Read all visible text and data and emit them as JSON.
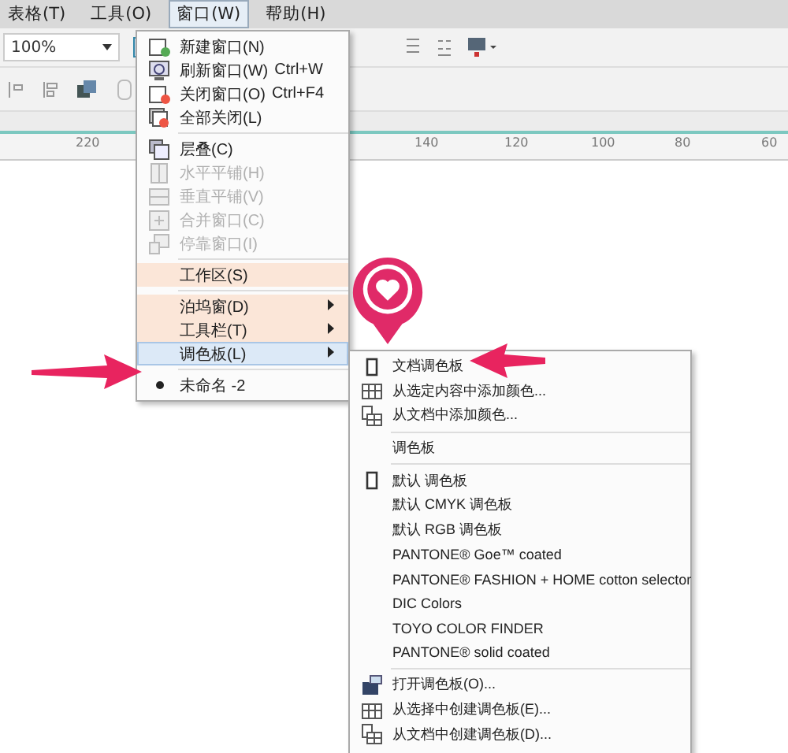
{
  "menubar": [
    {
      "label": "表格(T)",
      "selected": false
    },
    {
      "label": "工具(O)",
      "selected": false
    },
    {
      "label": "窗口(W)",
      "selected": true
    },
    {
      "label": "帮助(H)",
      "selected": false
    }
  ],
  "toolbar": {
    "zoom": "100%"
  },
  "ruler": {
    "labels": [
      "220",
      "140",
      "120",
      "100",
      "80",
      "60"
    ]
  },
  "window_menu": [
    {
      "kind": "item",
      "label": "新建窗口(N)",
      "disabled": false
    },
    {
      "kind": "item",
      "label": "刷新窗口(W)",
      "shortcut": "Ctrl+W",
      "disabled": false
    },
    {
      "kind": "item",
      "label": "关闭窗口(O)",
      "shortcut": "Ctrl+F4",
      "disabled": false
    },
    {
      "kind": "item",
      "label": "全部关闭(L)",
      "disabled": false
    },
    {
      "kind": "separator"
    },
    {
      "kind": "item",
      "label": "层叠(C)",
      "disabled": false
    },
    {
      "kind": "item",
      "label": "水平平铺(H)",
      "disabled": true
    },
    {
      "kind": "item",
      "label": "垂直平铺(V)",
      "disabled": true
    },
    {
      "kind": "item",
      "label": "合并窗口(C)",
      "disabled": true
    },
    {
      "kind": "item",
      "label": "停靠窗口(I)",
      "disabled": true
    },
    {
      "kind": "separator"
    },
    {
      "kind": "item",
      "label": "工作区(S)",
      "highlight": true,
      "disabled": false
    },
    {
      "kind": "separator"
    },
    {
      "kind": "item",
      "label": "泊坞窗(D)",
      "highlight": true,
      "submenu": true,
      "disabled": false
    },
    {
      "kind": "item",
      "label": "工具栏(T)",
      "highlight": true,
      "submenu": true,
      "disabled": false
    },
    {
      "kind": "item",
      "label": "调色板(L)",
      "selected": true,
      "submenu": true,
      "disabled": false
    },
    {
      "kind": "separator"
    },
    {
      "kind": "item",
      "label": "未命名 -2",
      "checked": true,
      "disabled": false
    }
  ],
  "palette_menu": [
    {
      "kind": "item",
      "label": "文档调色板"
    },
    {
      "kind": "item",
      "label": "从选定内容中添加颜色..."
    },
    {
      "kind": "item",
      "label": "从文档中添加颜色..."
    },
    {
      "kind": "separator"
    },
    {
      "kind": "header",
      "label": "调色板"
    },
    {
      "kind": "separator"
    },
    {
      "kind": "item",
      "label": "默认 调色板"
    },
    {
      "kind": "item",
      "label": "默认 CMYK 调色板"
    },
    {
      "kind": "item",
      "label": "默认 RGB 调色板"
    },
    {
      "kind": "item",
      "label": "PANTONE® Goe™ coated"
    },
    {
      "kind": "item",
      "label": "PANTONE® FASHION + HOME cotton selector"
    },
    {
      "kind": "item",
      "label": "DIC Colors"
    },
    {
      "kind": "item",
      "label": "TOYO COLOR FINDER"
    },
    {
      "kind": "item",
      "label": "PANTONE® solid coated"
    },
    {
      "kind": "separator"
    },
    {
      "kind": "item",
      "label": "打开调色板(O)..."
    },
    {
      "kind": "item",
      "label": "从选择中创建调色板(E)..."
    },
    {
      "kind": "item",
      "label": "从文档中创建调色板(D)..."
    }
  ]
}
